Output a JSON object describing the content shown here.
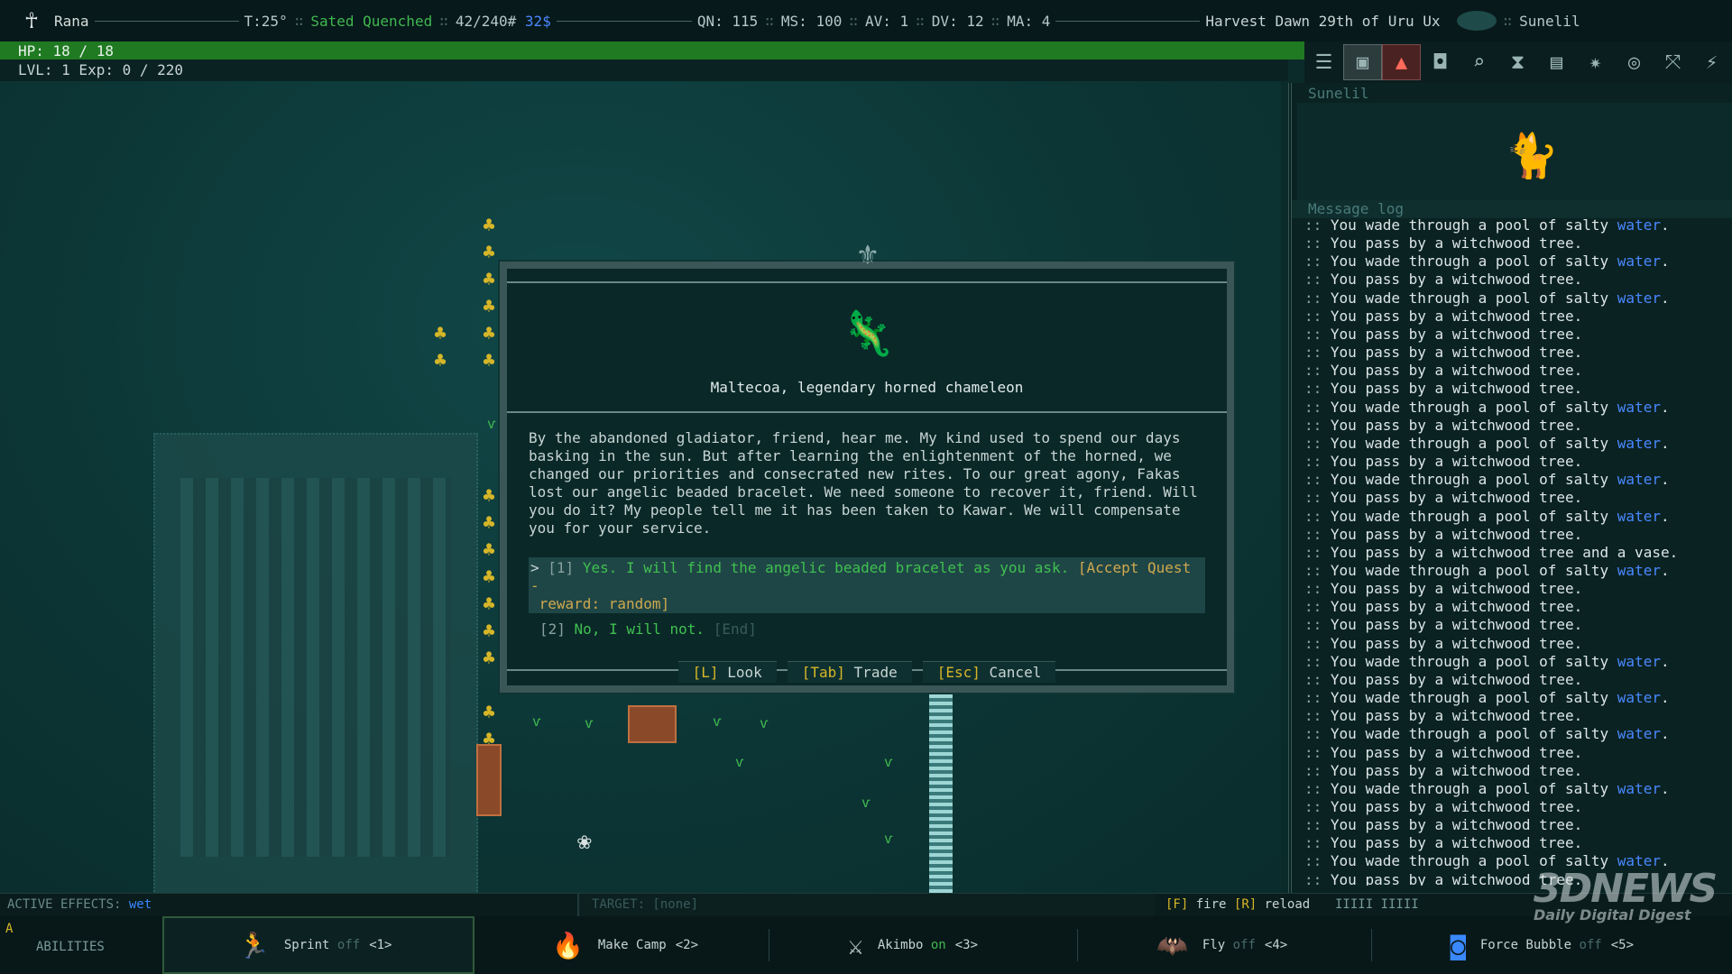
{
  "topbar": {
    "player_name": "Rana",
    "temperature": "T:25°",
    "hunger": "Sated Quenched",
    "weight": "42/240#",
    "money": "32$",
    "qn": "QN: 115",
    "ms": "MS: 100",
    "av": "AV: 1",
    "dv": "DV: 12",
    "ma": "MA: 4",
    "date": "Harvest Dawn 29th of Uru Ux",
    "location": "Sunelil"
  },
  "status": {
    "hp": "HP: 18 / 18",
    "level": "LVL: 1 Exp: 0 / 220"
  },
  "toolbar": {
    "icons": [
      "menu-icon",
      "inventory-icon",
      "character-icon",
      "map-icon",
      "look-icon",
      "wait-icon",
      "journal-icon",
      "skills-icon",
      "quests-icon",
      "abilities-icon",
      "settings-icon"
    ]
  },
  "dialog": {
    "speaker": "Maltecoa, legendary horned chameleon",
    "body": "By the abandoned gladiator, friend, hear me. My kind used to spend our days\nbasking in the sun. But after learning the enlightenment of the horned, we\nchanged our priorities and consecrated new rites. To our great agony, Fakas\nlost our angelic beaded bracelet. We need someone to recover it, friend. Will\nyou do it? My people tell me it has been taken to Kawar. We will compensate\nyou for your service.",
    "option1": {
      "caret": ">",
      "num": "[1]",
      "text": "Yes. I will find the angelic beaded bracelet as you ask.",
      "tag": "[Accept Quest -",
      "tag2": "reward: random]"
    },
    "option2": {
      "num": "[2]",
      "text": "No, I will not.",
      "tag": "[End]"
    },
    "buttons": {
      "look_key": "[L]",
      "look_label": "Look",
      "trade_key": "[Tab]",
      "trade_label": "Trade",
      "cancel_key": "[Esc]",
      "cancel_label": "Cancel"
    }
  },
  "right_panel": {
    "zone_name": "Sunelil",
    "message_log_title": "Message log",
    "messages": [
      {
        "t": "You wade through a pool of salty",
        "w": "water",
        "e": "."
      },
      {
        "t": "You pass by a witchwood tree.",
        "w": "",
        "e": ""
      },
      {
        "t": "You wade through a pool of salty",
        "w": "water",
        "e": "."
      },
      {
        "t": "You pass by a witchwood tree.",
        "w": "",
        "e": ""
      },
      {
        "t": "You wade through a pool of salty",
        "w": "water",
        "e": "."
      },
      {
        "t": "You pass by a witchwood tree.",
        "w": "",
        "e": ""
      },
      {
        "t": "You pass by a witchwood tree.",
        "w": "",
        "e": ""
      },
      {
        "t": "You pass by a witchwood tree.",
        "w": "",
        "e": ""
      },
      {
        "t": "You pass by a witchwood tree.",
        "w": "",
        "e": ""
      },
      {
        "t": "You pass by a witchwood tree.",
        "w": "",
        "e": ""
      },
      {
        "t": "You wade through a pool of salty",
        "w": "water",
        "e": "."
      },
      {
        "t": "You pass by a witchwood tree.",
        "w": "",
        "e": ""
      },
      {
        "t": "You wade through a pool of salty",
        "w": "water",
        "e": "."
      },
      {
        "t": "You pass by a witchwood tree.",
        "w": "",
        "e": ""
      },
      {
        "t": "You wade through a pool of salty",
        "w": "water",
        "e": "."
      },
      {
        "t": "You pass by a witchwood tree.",
        "w": "",
        "e": ""
      },
      {
        "t": "You wade through a pool of salty",
        "w": "water",
        "e": "."
      },
      {
        "t": "You pass by a witchwood tree.",
        "w": "",
        "e": ""
      },
      {
        "t": "You pass by a witchwood tree and a vase.",
        "w": "",
        "e": ""
      },
      {
        "t": "You wade through a pool of salty",
        "w": "water",
        "e": "."
      },
      {
        "t": "You pass by a witchwood tree.",
        "w": "",
        "e": ""
      },
      {
        "t": "You pass by a witchwood tree.",
        "w": "",
        "e": ""
      },
      {
        "t": "You pass by a witchwood tree.",
        "w": "",
        "e": ""
      },
      {
        "t": "You pass by a witchwood tree.",
        "w": "",
        "e": ""
      },
      {
        "t": "You wade through a pool of salty",
        "w": "water",
        "e": "."
      },
      {
        "t": "You pass by a witchwood tree.",
        "w": "",
        "e": ""
      },
      {
        "t": "You wade through a pool of salty",
        "w": "water",
        "e": "."
      },
      {
        "t": "You pass by a witchwood tree.",
        "w": "",
        "e": ""
      },
      {
        "t": "You wade through a pool of salty",
        "w": "water",
        "e": "."
      },
      {
        "t": "You pass by a witchwood tree.",
        "w": "",
        "e": ""
      },
      {
        "t": "You pass by a witchwood tree.",
        "w": "",
        "e": ""
      },
      {
        "t": "You wade through a pool of salty",
        "w": "water",
        "e": "."
      },
      {
        "t": "You pass by a witchwood tree.",
        "w": "",
        "e": ""
      },
      {
        "t": "You pass by a witchwood tree.",
        "w": "",
        "e": ""
      },
      {
        "t": "You pass by a witchwood tree.",
        "w": "",
        "e": ""
      },
      {
        "t": "You wade through a pool of salty",
        "w": "water",
        "e": "."
      },
      {
        "t": "You pass by a witchwood tree.",
        "w": "",
        "e": ""
      }
    ]
  },
  "bottom": {
    "effects_label": "ACTIVE EFFECTS:",
    "effects_value": "wet",
    "target": "TARGET: [none]",
    "fire_key": "[F]",
    "fire_label": "fire",
    "reload_key": "[R]",
    "reload_label": "reload",
    "ammo": "IIIII   IIIII",
    "abilities_tag": "A",
    "abilities_label": "ABILITIES",
    "abilities": [
      {
        "name": "Sprint",
        "state": "off",
        "key": "<1>",
        "icon": "sprint-icon"
      },
      {
        "name": "Make Camp",
        "state": "",
        "key": "<2>",
        "icon": "campfire-icon"
      },
      {
        "name": "Akimbo",
        "state": "on",
        "key": "<3>",
        "icon": "akimbo-icon"
      },
      {
        "name": "Fly",
        "state": "off",
        "key": "<4>",
        "icon": "wings-icon"
      },
      {
        "name": "Force Bubble",
        "state": "off",
        "key": "<5>",
        "icon": "force-bubble-icon"
      }
    ]
  },
  "watermark": {
    "logo": "3DNEWS",
    "tagline": "Daily Digital Digest"
  },
  "colors": {
    "hp_bar": "#1f7a22",
    "water": "#4a88ff",
    "accept_green": "#3fc050",
    "quest_gold": "#cfa84e"
  }
}
